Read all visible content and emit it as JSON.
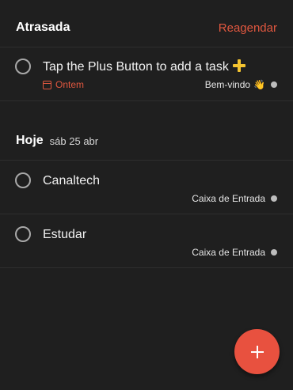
{
  "overdue": {
    "title": "Atrasada",
    "reschedule_label": "Reagendar"
  },
  "today": {
    "title": "Hoje",
    "date": "sáb 25 abr"
  },
  "tasks": [
    {
      "title": "Tap the Plus Button to add a task",
      "title_icon": "yellow-plus-icon",
      "due": "Ontem",
      "due_icon": "calendar-icon",
      "project": "Bem-vindo",
      "project_icon": "👋",
      "project_dot_color": "#bdbdbd"
    },
    {
      "title": "Canaltech",
      "project": "Caixa de Entrada",
      "project_dot_color": "#bdbdbd"
    },
    {
      "title": "Estudar",
      "project": "Caixa de Entrada",
      "project_dot_color": "#bdbdbd"
    }
  ],
  "fab": {
    "icon": "plus-icon",
    "color": "#e8513f"
  },
  "colors": {
    "background": "#1f1f1f",
    "accent": "#e0573f",
    "divider": "#2e2e2e"
  }
}
